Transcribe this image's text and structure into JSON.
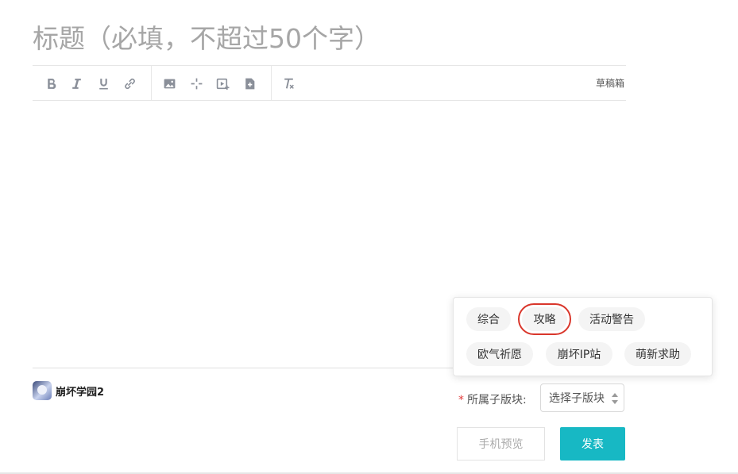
{
  "title_input": {
    "placeholder": "标题（必填，不超过50个字）"
  },
  "toolbar": {
    "draft_label": "草稿箱"
  },
  "forum": {
    "name": "崩坏学园2"
  },
  "subforum": {
    "label": "所属子版块:",
    "required_mark": "*",
    "select_value": "选择子版块",
    "options": [
      "综合",
      "攻略",
      "活动警告",
      "欧气祈愿",
      "崩坏IP站",
      "萌新求助"
    ],
    "highlighted": "攻略"
  },
  "actions": {
    "preview_label": "手机预览",
    "publish_label": "发表"
  },
  "colors": {
    "accent": "#17b8c4",
    "highlight_border": "#d9362b",
    "required": "#e23b3b"
  }
}
